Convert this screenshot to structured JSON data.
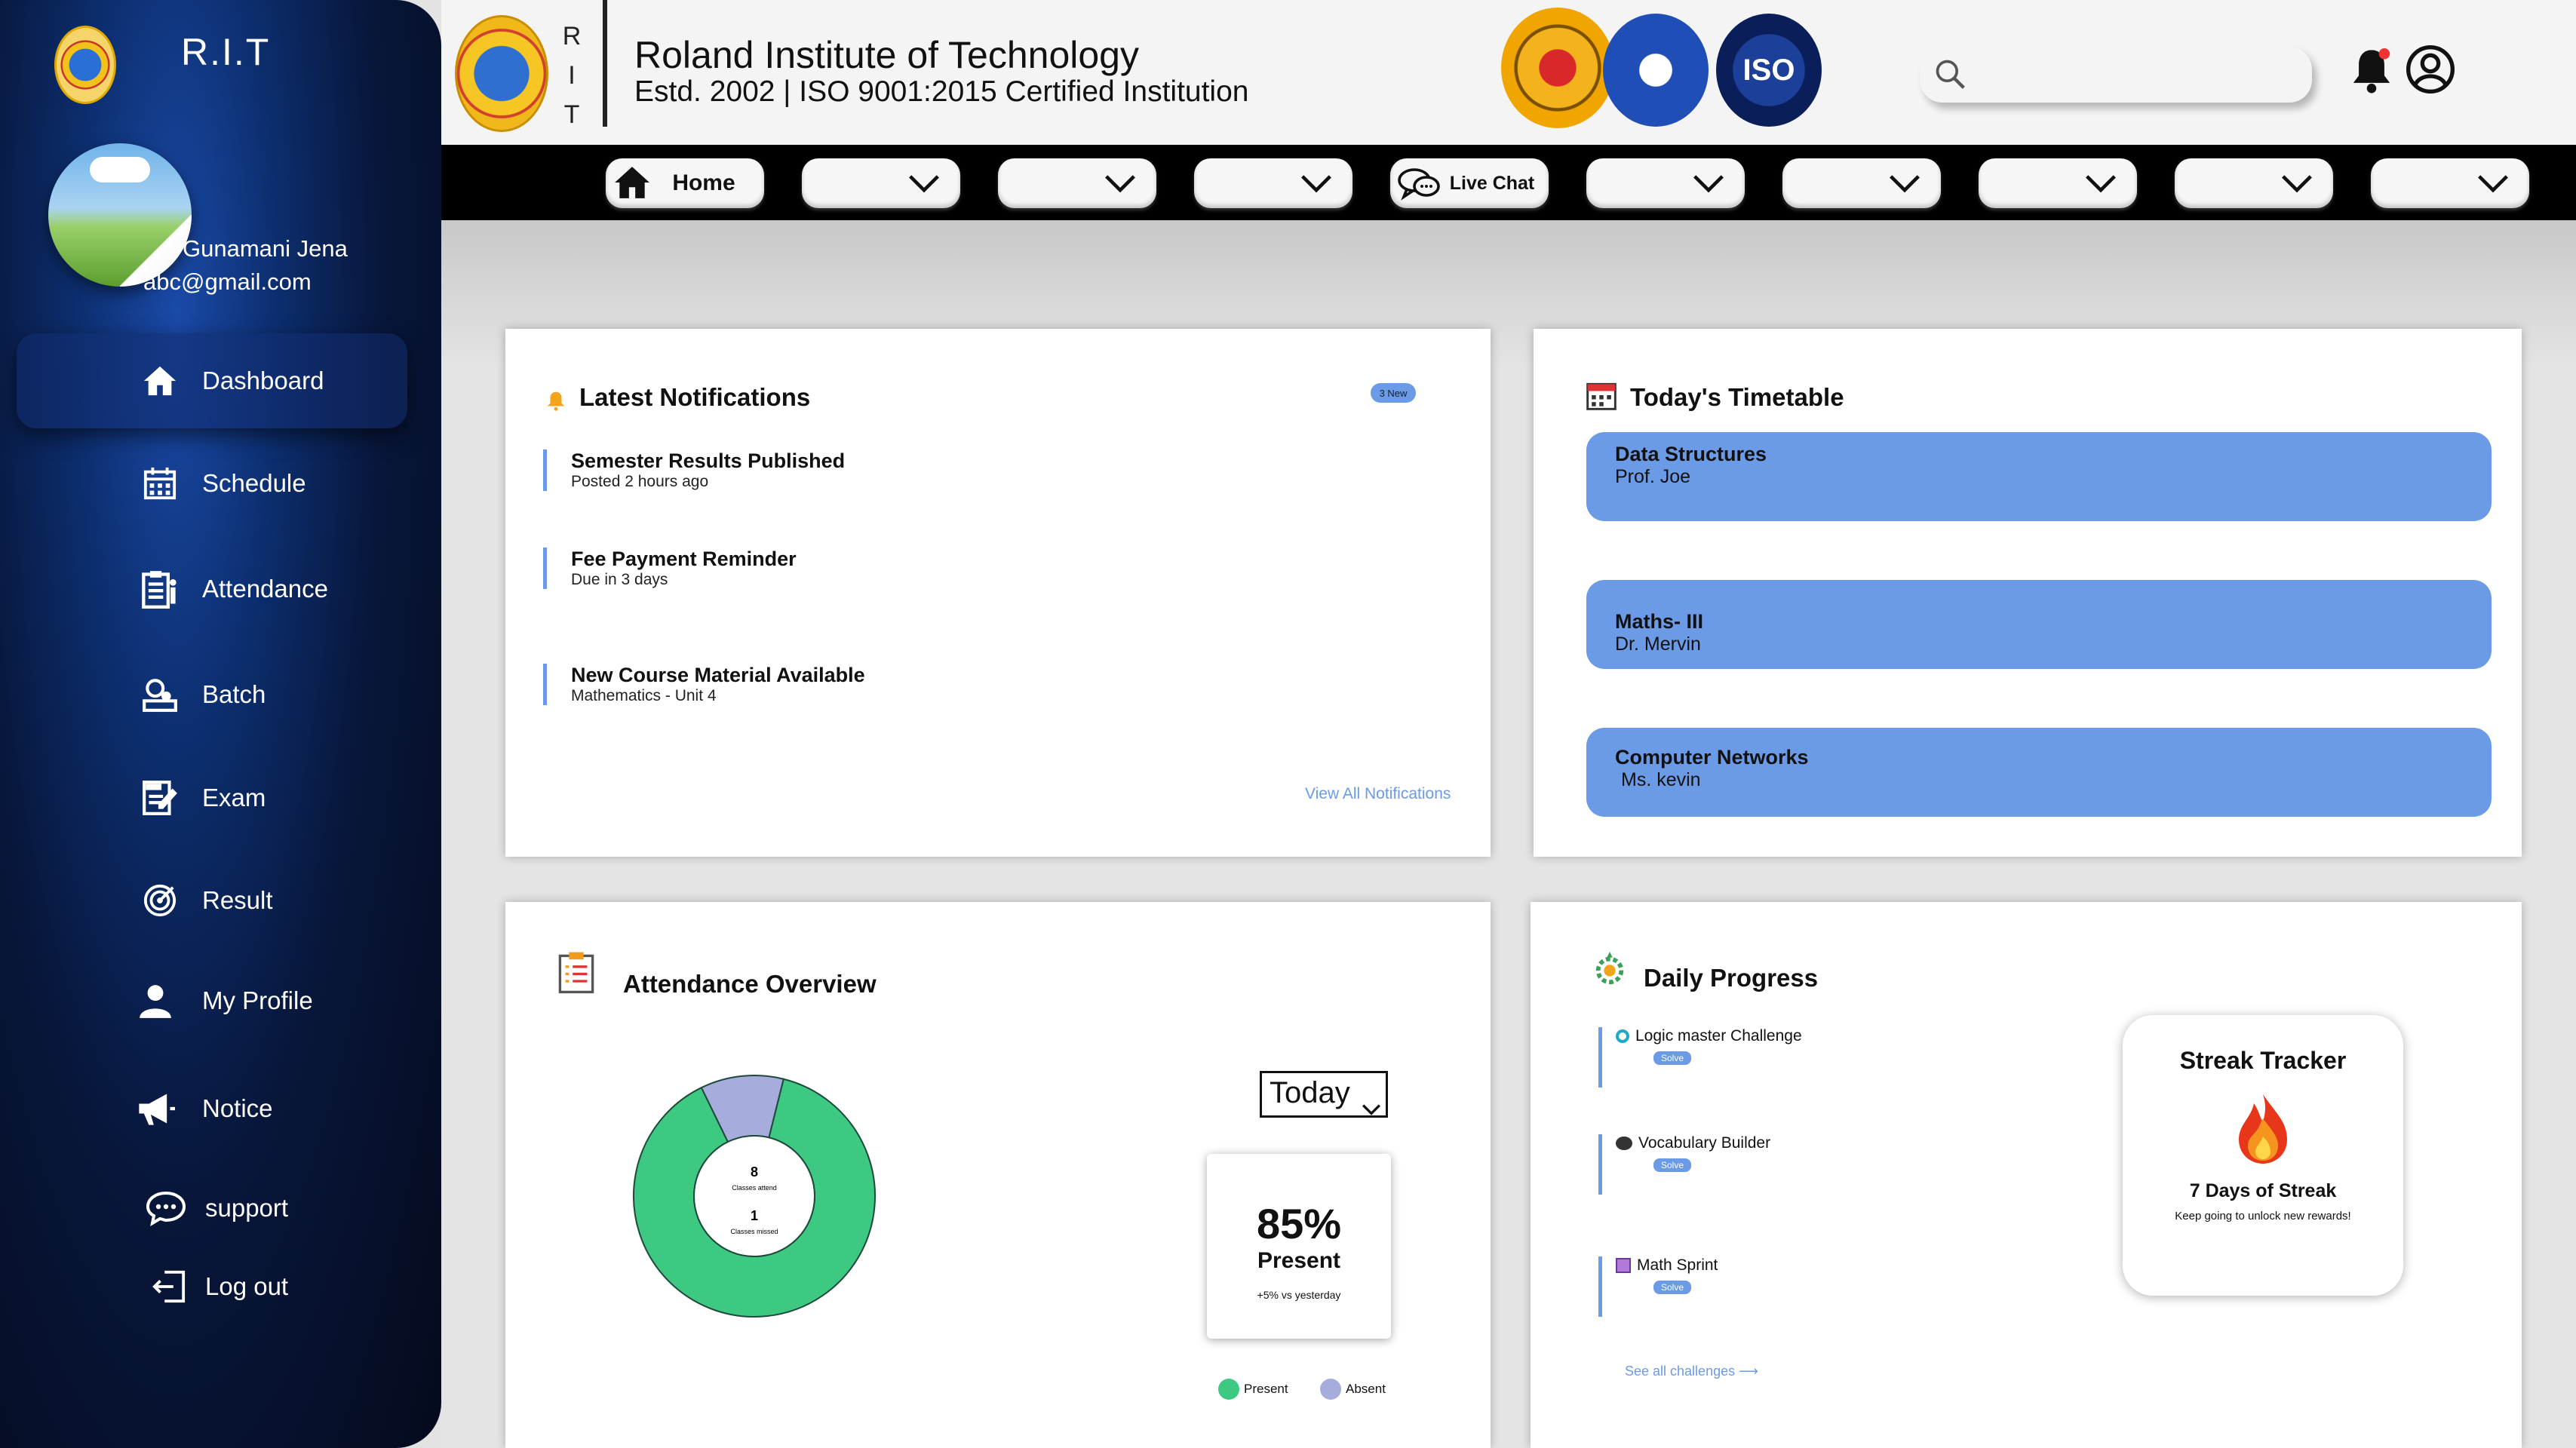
{
  "sidebar": {
    "title": "R.I.T",
    "user_name": "Gunamani Jena",
    "user_email": "abc@gmail.com",
    "items": [
      {
        "label": "Dashboard",
        "icon": "home-icon",
        "active": true
      },
      {
        "label": "Schedule",
        "icon": "calendar-icon"
      },
      {
        "label": "Attendance",
        "icon": "clipboard-icon"
      },
      {
        "label": "Batch",
        "icon": "batch-icon"
      },
      {
        "label": "Exam",
        "icon": "exam-icon"
      },
      {
        "label": "Result",
        "icon": "target-icon"
      },
      {
        "label": "My Profile",
        "icon": "user-icon"
      },
      {
        "label": "Notice",
        "icon": "megaphone-icon"
      }
    ],
    "support_label": "support",
    "logout_label": "Log out"
  },
  "header": {
    "rit_letters": [
      "R",
      "I",
      "T"
    ],
    "institute_name": "Roland Institute of Technology",
    "subtitle": "Estd. 2002 | ISO 9001:2015 Certified Institution",
    "seal_iso_text": "ISO",
    "search_placeholder": ""
  },
  "topnav": {
    "home_label": "Home",
    "live_chat_label": "Live Chat"
  },
  "notifications": {
    "title": "Latest Notifications",
    "badge": "3 New",
    "items": [
      {
        "title": "Semester Results Published",
        "subtitle": "Posted 2 hours ago"
      },
      {
        "title": "Fee Payment Reminder",
        "subtitle": "Due in 3 days"
      },
      {
        "title": "New Course Material Available",
        "subtitle": "Mathematics - Unit 4"
      }
    ],
    "view_all": "View All Notifications"
  },
  "timetable": {
    "title": "Today's Timetable",
    "slots": [
      {
        "subject": "Data Structures",
        "teacher": "Prof. Joe"
      },
      {
        "subject": "Maths- III",
        "teacher": "Dr. Mervin"
      },
      {
        "subject": "Computer Networks",
        "teacher": "Ms. kevin"
      }
    ]
  },
  "attendance": {
    "title": "Attendance Overview",
    "period": "Today",
    "percent": "85%",
    "percent_label": "Present",
    "delta": "+5% vs yesterday",
    "legend_present": "Present",
    "legend_absent": "Absent",
    "colors": {
      "present": "#3ec983",
      "absent": "#a6acdc"
    }
  },
  "chart_data": {
    "type": "pie",
    "categories": [
      "Present",
      "Absent"
    ],
    "values": [
      8,
      1
    ],
    "center_labels": [
      {
        "value": "8",
        "label": "Classes attend"
      },
      {
        "value": "1",
        "label": "Classes missed"
      }
    ]
  },
  "progress": {
    "title": "Daily Progress",
    "challenges": [
      {
        "name": "Logic master Challenge",
        "action": "Solve",
        "icon": "target-dot-icon"
      },
      {
        "name": "Vocabulary Builder",
        "action": "Solve",
        "icon": "brain-icon"
      },
      {
        "name": "Math Sprint",
        "action": "Solve",
        "icon": "book-icon"
      }
    ],
    "see_all": "See all challenges ⟶",
    "streak_title": "Streak Tracker",
    "streak_days": "7 Days of Streak",
    "streak_sub": "Keep going to unlock new rewards!"
  }
}
